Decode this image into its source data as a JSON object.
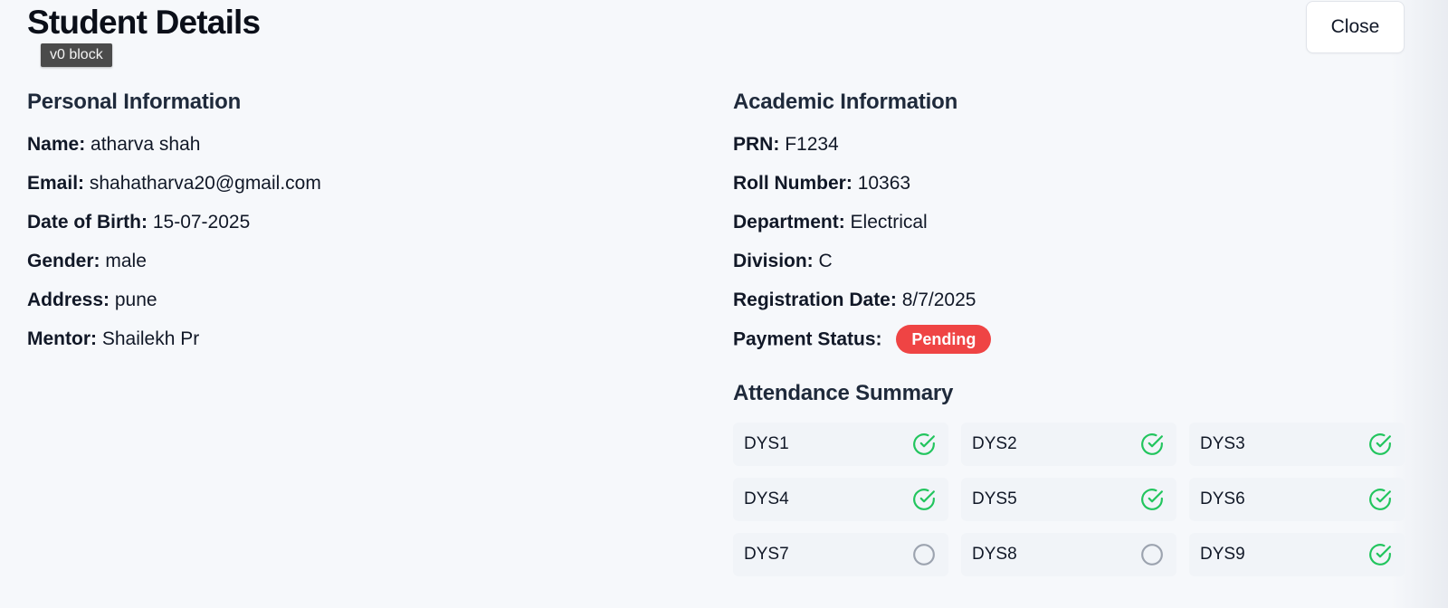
{
  "header": {
    "title": "Student Details",
    "tooltip": "v0 block",
    "close_label": "Close"
  },
  "personal": {
    "heading": "Personal Information",
    "fields": [
      {
        "label": "Name:",
        "value": "atharva shah"
      },
      {
        "label": "Email:",
        "value": "shahatharva20@gmail.com"
      },
      {
        "label": "Date of Birth:",
        "value": "15-07-2025"
      },
      {
        "label": "Gender:",
        "value": "male"
      },
      {
        "label": "Address:",
        "value": "pune"
      },
      {
        "label": "Mentor:",
        "value": "Shailekh Pr"
      }
    ]
  },
  "academic": {
    "heading": "Academic Information",
    "fields": [
      {
        "label": "PRN:",
        "value": "F1234"
      },
      {
        "label": "Roll Number:",
        "value": "10363"
      },
      {
        "label": "Department:",
        "value": "Electrical"
      },
      {
        "label": "Division:",
        "value": "C"
      },
      {
        "label": "Registration Date:",
        "value": "8/7/2025"
      }
    ],
    "payment": {
      "label": "Payment Status:",
      "status": "Pending",
      "status_color": "#ef4444"
    }
  },
  "attendance": {
    "heading": "Attendance Summary",
    "present_color": "#22c55e",
    "absent_color": "#9ca3af",
    "days": [
      {
        "label": "DYS1",
        "icon": "check-circle-icon"
      },
      {
        "label": "DYS2",
        "icon": "check-circle-icon"
      },
      {
        "label": "DYS3",
        "icon": "check-circle-icon"
      },
      {
        "label": "DYS4",
        "icon": "check-circle-icon"
      },
      {
        "label": "DYS5",
        "icon": "check-circle-icon"
      },
      {
        "label": "DYS6",
        "icon": "check-circle-icon"
      },
      {
        "label": "DYS7",
        "icon": "empty-circle-icon"
      },
      {
        "label": "DYS8",
        "icon": "empty-circle-icon"
      },
      {
        "label": "DYS9",
        "icon": "check-circle-icon"
      }
    ]
  }
}
